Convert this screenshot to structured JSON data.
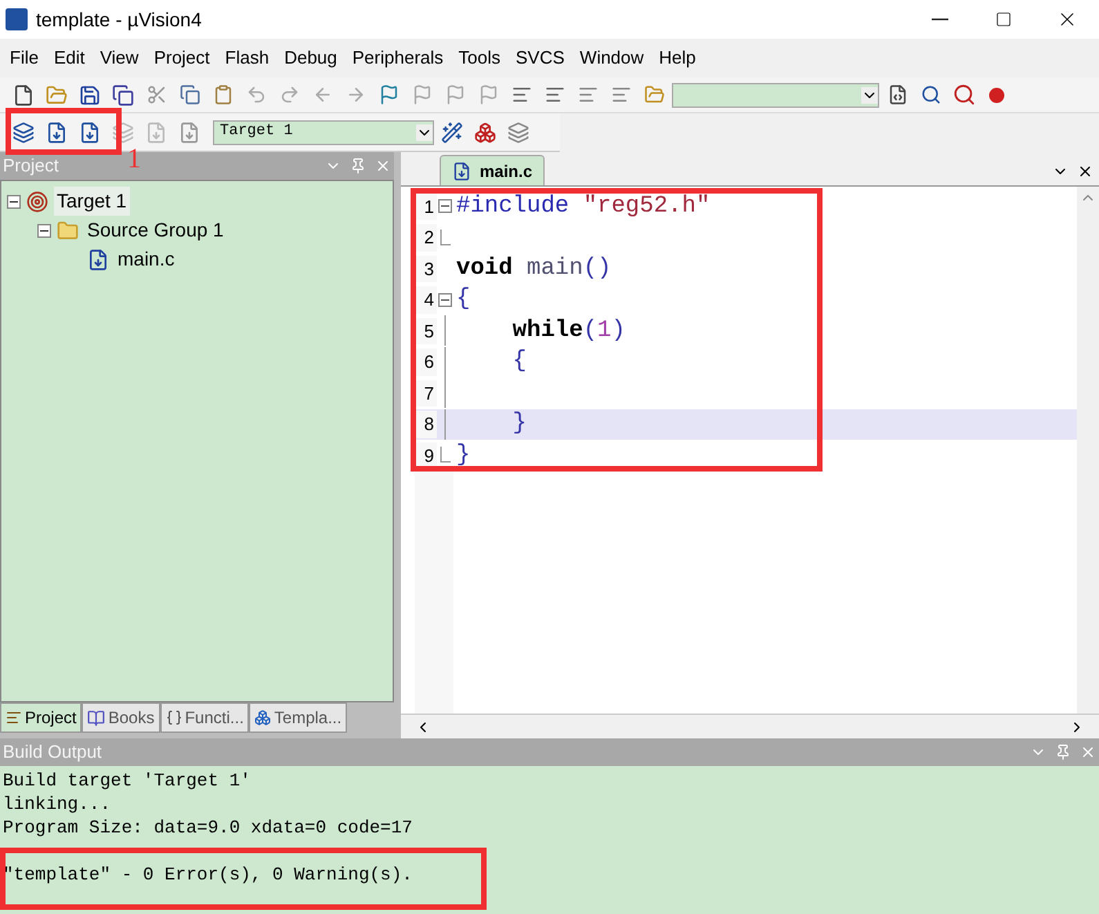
{
  "window": {
    "title": "template  - µVision4"
  },
  "menu": [
    "File",
    "Edit",
    "View",
    "Project",
    "Flash",
    "Debug",
    "Peripherals",
    "Tools",
    "SVCS",
    "Window",
    "Help"
  ],
  "toolbar2": {
    "target": "Target 1"
  },
  "project_panel": {
    "title": "Project",
    "tree": [
      {
        "label": "Target 1",
        "kind": "target",
        "expanded": true,
        "selected": true,
        "children": [
          {
            "label": "Source Group 1",
            "kind": "group",
            "expanded": true,
            "selected": false,
            "children": [
              {
                "label": "main.c",
                "kind": "file",
                "selected": false
              }
            ]
          }
        ]
      }
    ],
    "tabs": [
      {
        "label": "Project",
        "kind": "project",
        "selected": true
      },
      {
        "label": "Books",
        "kind": "books",
        "selected": false
      },
      {
        "label": "Functi...",
        "kind": "functions",
        "selected": false
      },
      {
        "label": "Templa...",
        "kind": "templates",
        "selected": false
      }
    ]
  },
  "editor": {
    "tab": "main.c",
    "lines": [
      {
        "number": "1",
        "kind": "fold_start",
        "current": false,
        "segments": [
          {
            "text": "#include",
            "kind": "preprocessor"
          },
          {
            "text": " \"reg52.h\"",
            "kind": "string"
          }
        ]
      },
      {
        "number": "2",
        "kind": "fold_end",
        "current": false
      },
      {
        "number": "3",
        "kind": "plain",
        "current": false,
        "segments": [
          {
            "text": "void",
            "kind": "keyword"
          },
          {
            "text": " main",
            "kind": "plain"
          },
          {
            "text": "()",
            "kind": "punct"
          }
        ]
      },
      {
        "number": "4",
        "kind": "fold_start",
        "current": false,
        "segments": [
          {
            "text": "{",
            "kind": "punct"
          }
        ]
      },
      {
        "number": "5",
        "kind": "fold_body",
        "current": false,
        "segments": [
          {
            "text": "    while",
            "kind": "keyword"
          },
          {
            "text": "(",
            "kind": "punct"
          },
          {
            "text": "1",
            "kind": "number"
          },
          {
            "text": ")",
            "kind": "punct"
          }
        ]
      },
      {
        "number": "6",
        "kind": "fold_body",
        "current": false,
        "segments": [
          {
            "text": "    {",
            "kind": "punct"
          }
        ]
      },
      {
        "number": "7",
        "kind": "fold_body",
        "current": false
      },
      {
        "number": "8",
        "kind": "fold_body",
        "current": true,
        "segments": [
          {
            "text": "    }",
            "kind": "punct"
          }
        ]
      },
      {
        "number": "9",
        "kind": "fold_end",
        "current": false,
        "segments": [
          {
            "text": "}",
            "kind": "punct"
          }
        ]
      }
    ]
  },
  "build_output": {
    "title": "Build Output",
    "lines": [
      "Build target 'Target 1'",
      "linking...",
      "Program Size: data=9.0 xdata=0 code=17",
      "\"template\" - 0 Error(s), 0 Warning(s)."
    ]
  },
  "annotations": [
    {
      "label": "1"
    }
  ]
}
